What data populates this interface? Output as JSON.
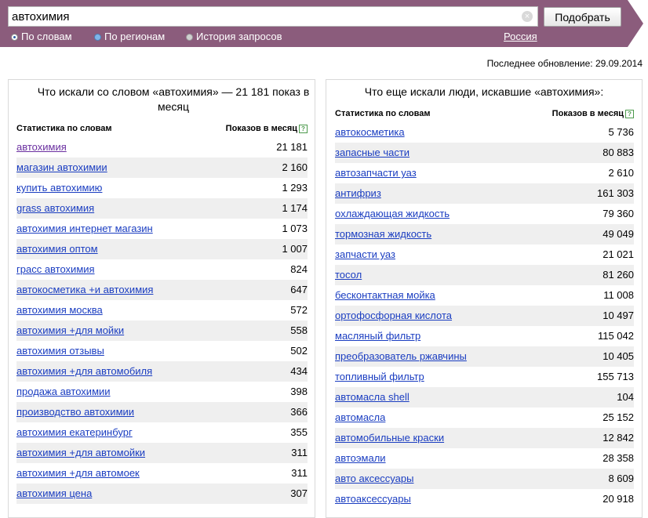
{
  "search": {
    "value": "автохимия",
    "submit_label": "Подобрать",
    "clear_icon": "clear-icon"
  },
  "modes": [
    {
      "label": "По словам",
      "selected": true
    },
    {
      "label": "По регионам",
      "selected": false
    },
    {
      "label": "История запросов",
      "selected": false
    }
  ],
  "region": "Россия",
  "updated": "Последнее обновление: 29.09.2014",
  "left": {
    "title": "Что искали со словом «автохимия» — 21 181 показ в месяц",
    "col_query": "Статистика по словам",
    "col_count": "Показов в месяц",
    "rows": [
      {
        "q": "автохимия",
        "n": "21 181"
      },
      {
        "q": "магазин автохимии",
        "n": "2 160"
      },
      {
        "q": "купить автохимию",
        "n": "1 293"
      },
      {
        "q": "grass автохимия",
        "n": "1 174"
      },
      {
        "q": "автохимия интернет магазин",
        "n": "1 073"
      },
      {
        "q": "автохимия оптом",
        "n": "1 007"
      },
      {
        "q": "грасс автохимия",
        "n": "824"
      },
      {
        "q": "автокосметика +и автохимия",
        "n": "647"
      },
      {
        "q": "автохимия москва",
        "n": "572"
      },
      {
        "q": "автохимия +для мойки",
        "n": "558"
      },
      {
        "q": "автохимия отзывы",
        "n": "502"
      },
      {
        "q": "автохимия +для автомобиля",
        "n": "434"
      },
      {
        "q": "продажа автохимии",
        "n": "398"
      },
      {
        "q": "производство автохимии",
        "n": "366"
      },
      {
        "q": "автохимия екатеринбург",
        "n": "355"
      },
      {
        "q": "автохимия +для автомойки",
        "n": "311"
      },
      {
        "q": "автохимия +для автомоек",
        "n": "311"
      },
      {
        "q": "автохимия цена",
        "n": "307"
      }
    ]
  },
  "right": {
    "title": "Что еще искали люди, искавшие «автохимия»:",
    "col_query": "Статистика по словам",
    "col_count": "Показов в месяц",
    "rows": [
      {
        "q": "автокосметика",
        "n": "5 736"
      },
      {
        "q": "запасные части",
        "n": "80 883"
      },
      {
        "q": "автозапчасти уаз",
        "n": "2 610"
      },
      {
        "q": "антифриз",
        "n": "161 303"
      },
      {
        "q": "охлаждающая жидкость",
        "n": "79 360"
      },
      {
        "q": "тормозная жидкость",
        "n": "49 049"
      },
      {
        "q": "запчасти уаз",
        "n": "21 021"
      },
      {
        "q": "тосол",
        "n": "81 260"
      },
      {
        "q": "бесконтактная мойка",
        "n": "11 008"
      },
      {
        "q": "ортофосфорная кислота",
        "n": "10 497"
      },
      {
        "q": "масляный фильтр",
        "n": "115 042"
      },
      {
        "q": "преобразователь ржавчины",
        "n": "10 405"
      },
      {
        "q": "топливный фильтр",
        "n": "155 713"
      },
      {
        "q": "автомасла shell",
        "n": "104"
      },
      {
        "q": "автомасла",
        "n": "25 152"
      },
      {
        "q": "автомобильные краски",
        "n": "12 842"
      },
      {
        "q": "автоэмали",
        "n": "28 358"
      },
      {
        "q": "авто аксессуары",
        "n": "8 609"
      },
      {
        "q": "автоаксессуары",
        "n": "20 918"
      }
    ]
  },
  "colors": {
    "header_band": "#8b5c7c",
    "link": "#1a3dc1",
    "visited_link": "#6a2fa0",
    "row_alt": "#efefef"
  }
}
